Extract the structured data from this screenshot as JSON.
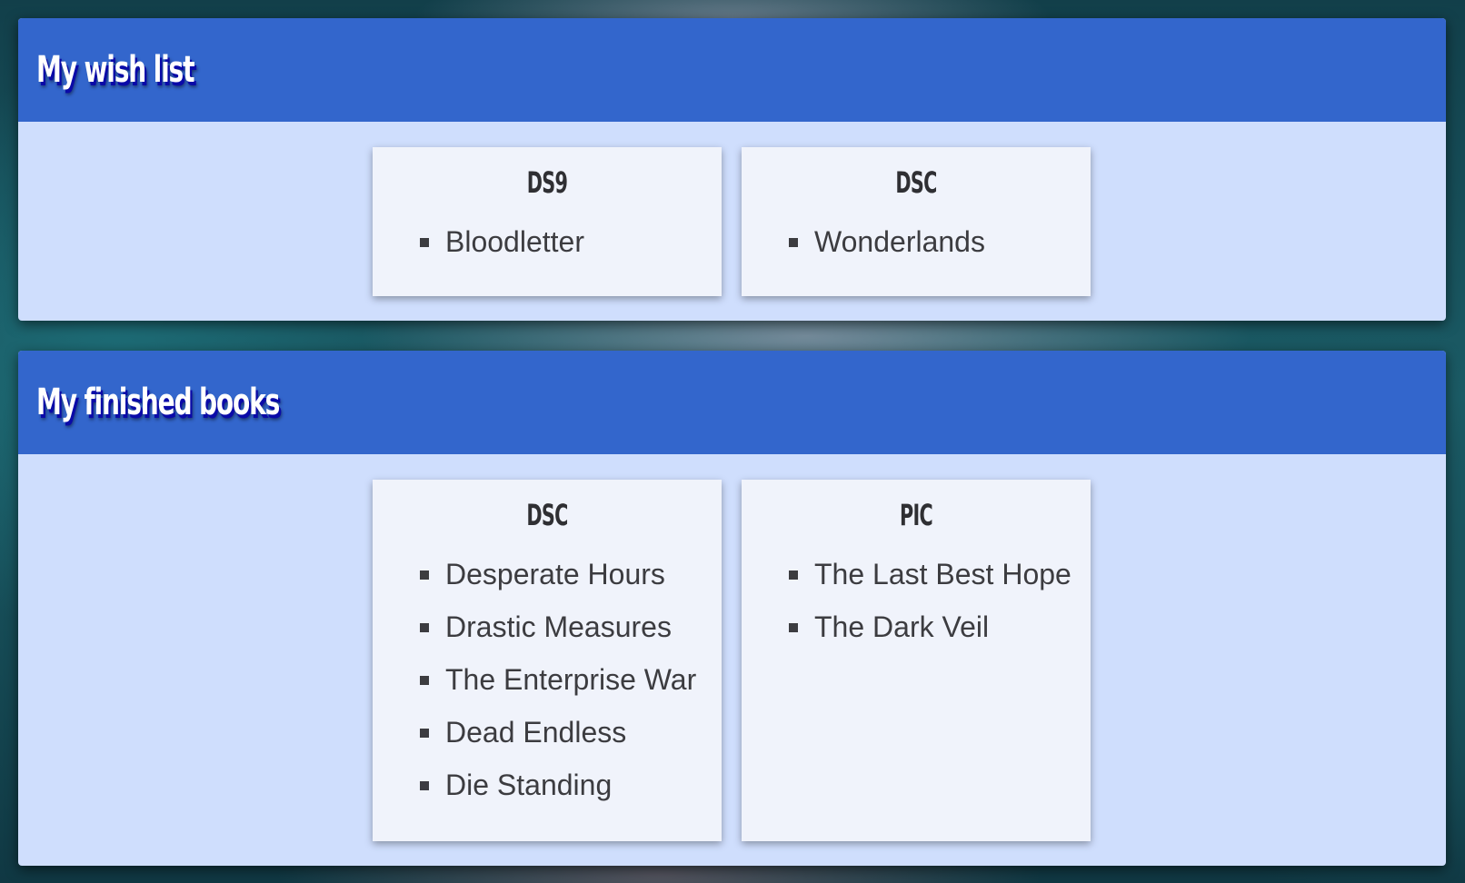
{
  "sections": [
    {
      "title": "My wish list",
      "cards": [
        {
          "title": "DS9",
          "items": [
            "Bloodletter"
          ]
        },
        {
          "title": "DSC",
          "items": [
            "Wonderlands"
          ]
        }
      ]
    },
    {
      "title": "My finished books",
      "cards": [
        {
          "title": "DSC",
          "items": [
            "Desperate Hours",
            "Drastic Measures",
            "The Enterprise War",
            "Dead Endless",
            "Die Standing"
          ]
        },
        {
          "title": "PIC",
          "items": [
            "The Last Best Hope",
            "The Dark Veil"
          ]
        }
      ]
    }
  ],
  "colors": {
    "header_blue": "#3366cc",
    "panel_bg": "#cfdefd",
    "card_bg": "#f0f3fb",
    "text": "#3c3c40"
  },
  "icons": {
    "list_bullet": "square-bullet-icon"
  }
}
